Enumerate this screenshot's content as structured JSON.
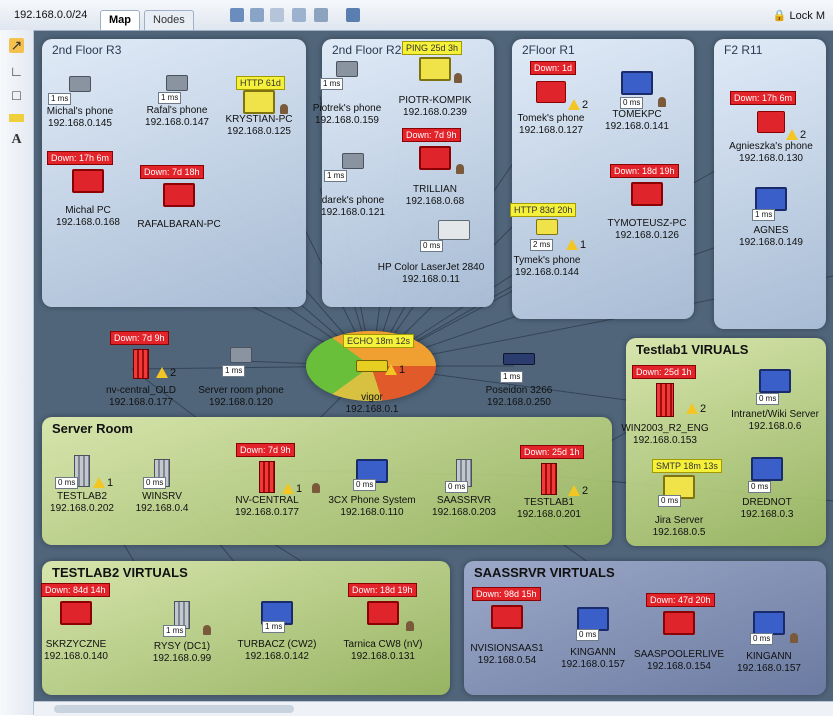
{
  "toolbar": {
    "network": "192.168.0.0/24",
    "tabs": [
      {
        "label": "Map",
        "active": true
      },
      {
        "label": "Nodes",
        "active": false
      }
    ],
    "lock": "Lock M"
  },
  "colors": {
    "down": "#e3232a",
    "ok": "#f5f03a",
    "map_bg": "#50657a"
  },
  "groups": {
    "r3": "2nd Floor R3",
    "r2": "2nd Floor R2",
    "r1": "2Floor R1",
    "r11": "F2 R11",
    "server_room": "Server Room",
    "testlab1": "Testlab1 VIRUALS",
    "testlab2": "TESTLAB2 VIRTUALS",
    "saassrvr": "SAASSRVR VIRTUALS"
  },
  "nodes": {
    "michals_phone": {
      "name": "Michal's phone",
      "ip": "192.168.0.145",
      "ms": "1 ms",
      "icon": "phone-icon"
    },
    "rafals_phone": {
      "name": "Rafal's phone",
      "ip": "192.168.0.147",
      "ms": "1 ms",
      "icon": "phone-icon"
    },
    "krystian_pc": {
      "name": "KRYSTIAN-PC",
      "ip": "192.168.0.125",
      "badge": "HTTP 61d",
      "icon": "vista-pc-icon"
    },
    "michal_pc": {
      "name": "Michal PC",
      "ip": "192.168.0.168",
      "badge": "Down: 17h 6m",
      "icon": "pc-icon"
    },
    "rafalbaran_pc": {
      "name": "RAFALBARAN-PC",
      "badge": "Down: 7d 18h",
      "icon": "pc-icon"
    },
    "piotreks_phone": {
      "name": "Piotrek's phone",
      "ip": "192.168.0.159",
      "ms": "1 ms",
      "icon": "phone-icon"
    },
    "piotr_kompik": {
      "name": "PIOTR-KOMPIK",
      "ip": "192.168.0.239",
      "badge": "PING 25d 3h",
      "icon": "vista-pc-icon"
    },
    "dareks_phone": {
      "name": "darek's phone",
      "ip": "192.168.0.121",
      "ms": "1 ms",
      "icon": "phone-icon"
    },
    "trillian": {
      "name": "TRILLIAN",
      "ip": "192.168.0.68",
      "badge": "Down: 7d 9h",
      "icon": "pc-icon"
    },
    "hp_printer": {
      "name": "HP Color LaserJet 2840",
      "ip": "192.168.0.11",
      "ms": "0 ms",
      "icon": "printer-icon"
    },
    "tomeks_phone": {
      "name": "Tomek's phone",
      "ip": "192.168.0.127",
      "badge": "Down: 1d",
      "warn": "2",
      "icon": "phone-icon"
    },
    "tomekpc": {
      "name": "TOMEKPC",
      "ip": "192.168.0.141",
      "ms": "0 ms",
      "icon": "xp-pc-icon"
    },
    "tymoteusz_pc": {
      "name": "TYMOTEUSZ-PC",
      "ip": "192.168.0.126",
      "badge": "Down: 18d 19h",
      "icon": "vista-pc-icon"
    },
    "tymeks_phone": {
      "name": "Tymek's phone",
      "ip": "192.168.0.144",
      "badge": "HTTP 83d 20h",
      "ms": "2 ms",
      "warn": "1",
      "icon": "phone-icon"
    },
    "agnieszkas_phone": {
      "name": "Agnieszka's phone",
      "ip": "192.168.0.130",
      "badge": "Down: 17h 6m",
      "warn": "2",
      "icon": "phone-icon"
    },
    "agnes": {
      "name": "AGNES",
      "ip": "192.168.0.149",
      "ms": "1 ms",
      "icon": "xp-pc-icon"
    },
    "nv_central_old": {
      "name": "nv-central_OLD",
      "ip": "192.168.0.177",
      "badge": "Down: 7d 9h",
      "warn": "2",
      "icon": "server-icon"
    },
    "server_room_phone": {
      "name": "Server room phone",
      "ip": "192.168.0.120",
      "ms": "1 ms",
      "icon": "phone-icon"
    },
    "vigor": {
      "name": "vigor",
      "ip": "192.168.0.1",
      "badge": "ECHO 18m 12s",
      "warn": "1",
      "icon": "router-icon"
    },
    "poseidon": {
      "name": "Poseidon 3266",
      "ip": "192.168.0.250",
      "ms": "1 ms",
      "icon": "switch-icon"
    },
    "testlab2": {
      "name": "TESTLAB2",
      "ip": "192.168.0.202",
      "ms": "0 ms",
      "warn": "1",
      "icon": "server-icon"
    },
    "winsrv": {
      "name": "WINSRV",
      "ip": "192.168.0.4",
      "ms": "0 ms",
      "icon": "server-icon"
    },
    "nv_central": {
      "name": "NV-CENTRAL",
      "ip": "192.168.0.177",
      "badge": "Down: 7d 9h",
      "warn": "1",
      "icon": "server-icon"
    },
    "phone_3cx": {
      "name": "3CX Phone System",
      "ip": "192.168.0.110",
      "ms": "0 ms",
      "icon": "xp-pc-icon"
    },
    "saassrvr": {
      "name": "SAASSRVR",
      "ip": "192.168.0.203",
      "ms": "0 ms",
      "icon": "server-icon"
    },
    "testlab1": {
      "name": "TESTLAB1",
      "ip": "192.168.0.201",
      "badge": "Down: 25d 1h",
      "warn": "2",
      "icon": "server-icon"
    },
    "win2003": {
      "name": "WIN2003_R2_ENG",
      "ip": "192.168.0.153",
      "badge": "Down: 25d 1h",
      "warn": "2",
      "icon": "server-icon"
    },
    "intranet_wiki": {
      "name": "Intranet/Wiki Server",
      "ip": "192.168.0.6",
      "ms": "0 ms",
      "icon": "pc-icon"
    },
    "jira": {
      "name": "Jira Server",
      "ip": "192.168.0.5",
      "badge": "SMTP 18m 13s",
      "ms": "0 ms",
      "icon": "pc-icon"
    },
    "drednot": {
      "name": "DREDNOT",
      "ip": "192.168.0.3",
      "ms": "0 ms",
      "icon": "pc-icon"
    },
    "skrzyczne": {
      "name": "SKRZYCZNE",
      "ip": "192.168.0.140",
      "badge": "Down: 84d 14h",
      "icon": "pc-icon"
    },
    "rysy": {
      "name": "RYSY (DC1)",
      "ip": "192.168.0.99",
      "ms": "1 ms",
      "icon": "server-icon"
    },
    "turbacz": {
      "name": "TURBACZ (CW2)",
      "ip": "192.168.0.142",
      "ms": "1 ms",
      "icon": "vista-pc-icon"
    },
    "tarnica": {
      "name": "Tarnica CW8 (nV)",
      "ip": "192.168.0.131",
      "badge": "Down: 18d 19h",
      "icon": "vista-pc-icon"
    },
    "nvisionsaas1": {
      "name": "NVISIONSAAS1",
      "ip": "192.168.0.54",
      "badge": "Down: 98d 15h",
      "icon": "pc-icon"
    },
    "kingann1": {
      "name": "KINGANN",
      "ip": "192.168.0.157",
      "ms": "0 ms",
      "icon": "pc-icon"
    },
    "saaspoolerlive": {
      "name": "SAASPOOLERLIVE",
      "ip": "192.168.0.154",
      "badge": "Down: 47d 20h",
      "icon": "pc-icon"
    },
    "kingann2": {
      "name": "KINGANN",
      "ip": "192.168.0.157",
      "ms": "0 ms",
      "icon": "xp-pc-icon"
    }
  }
}
